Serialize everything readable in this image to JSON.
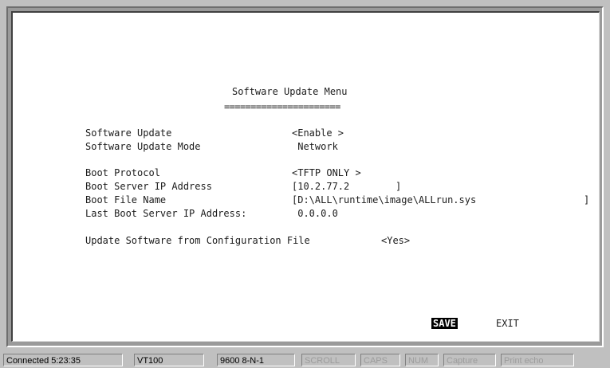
{
  "terminal": {
    "title": "Software Update Menu",
    "title_underline": "======================",
    "fields": [
      {
        "label": "Software Update",
        "value": "<Enable >"
      },
      {
        "label": "Software Update Mode",
        "value": " Network"
      },
      {
        "label": "Boot Protocol",
        "value": "<TFTP ONLY >"
      },
      {
        "label": "Boot Server IP Address",
        "value": "[10.2.77.2        ]"
      },
      {
        "label": "Boot File Name",
        "value": "[D:\\ALL\\runtime\\image\\ALLrun.sys"
      },
      {
        "label": "Last Boot Server IP Address:",
        "value": " 0.0.0.0"
      }
    ],
    "bootfile_close_bracket": "]",
    "config_file_label": "Update Software from Configuration File",
    "config_file_value": "<Yes>",
    "save_label": "SAVE",
    "exit_label": "EXIT"
  },
  "statusbar": {
    "connected": "Connected 5:23:35",
    "emulation": "VT100",
    "port_settings": "9600 8-N-1",
    "scroll": "SCROLL",
    "caps": "CAPS",
    "num": "NUM",
    "capture": "Capture",
    "print_echo": "Print echo"
  }
}
